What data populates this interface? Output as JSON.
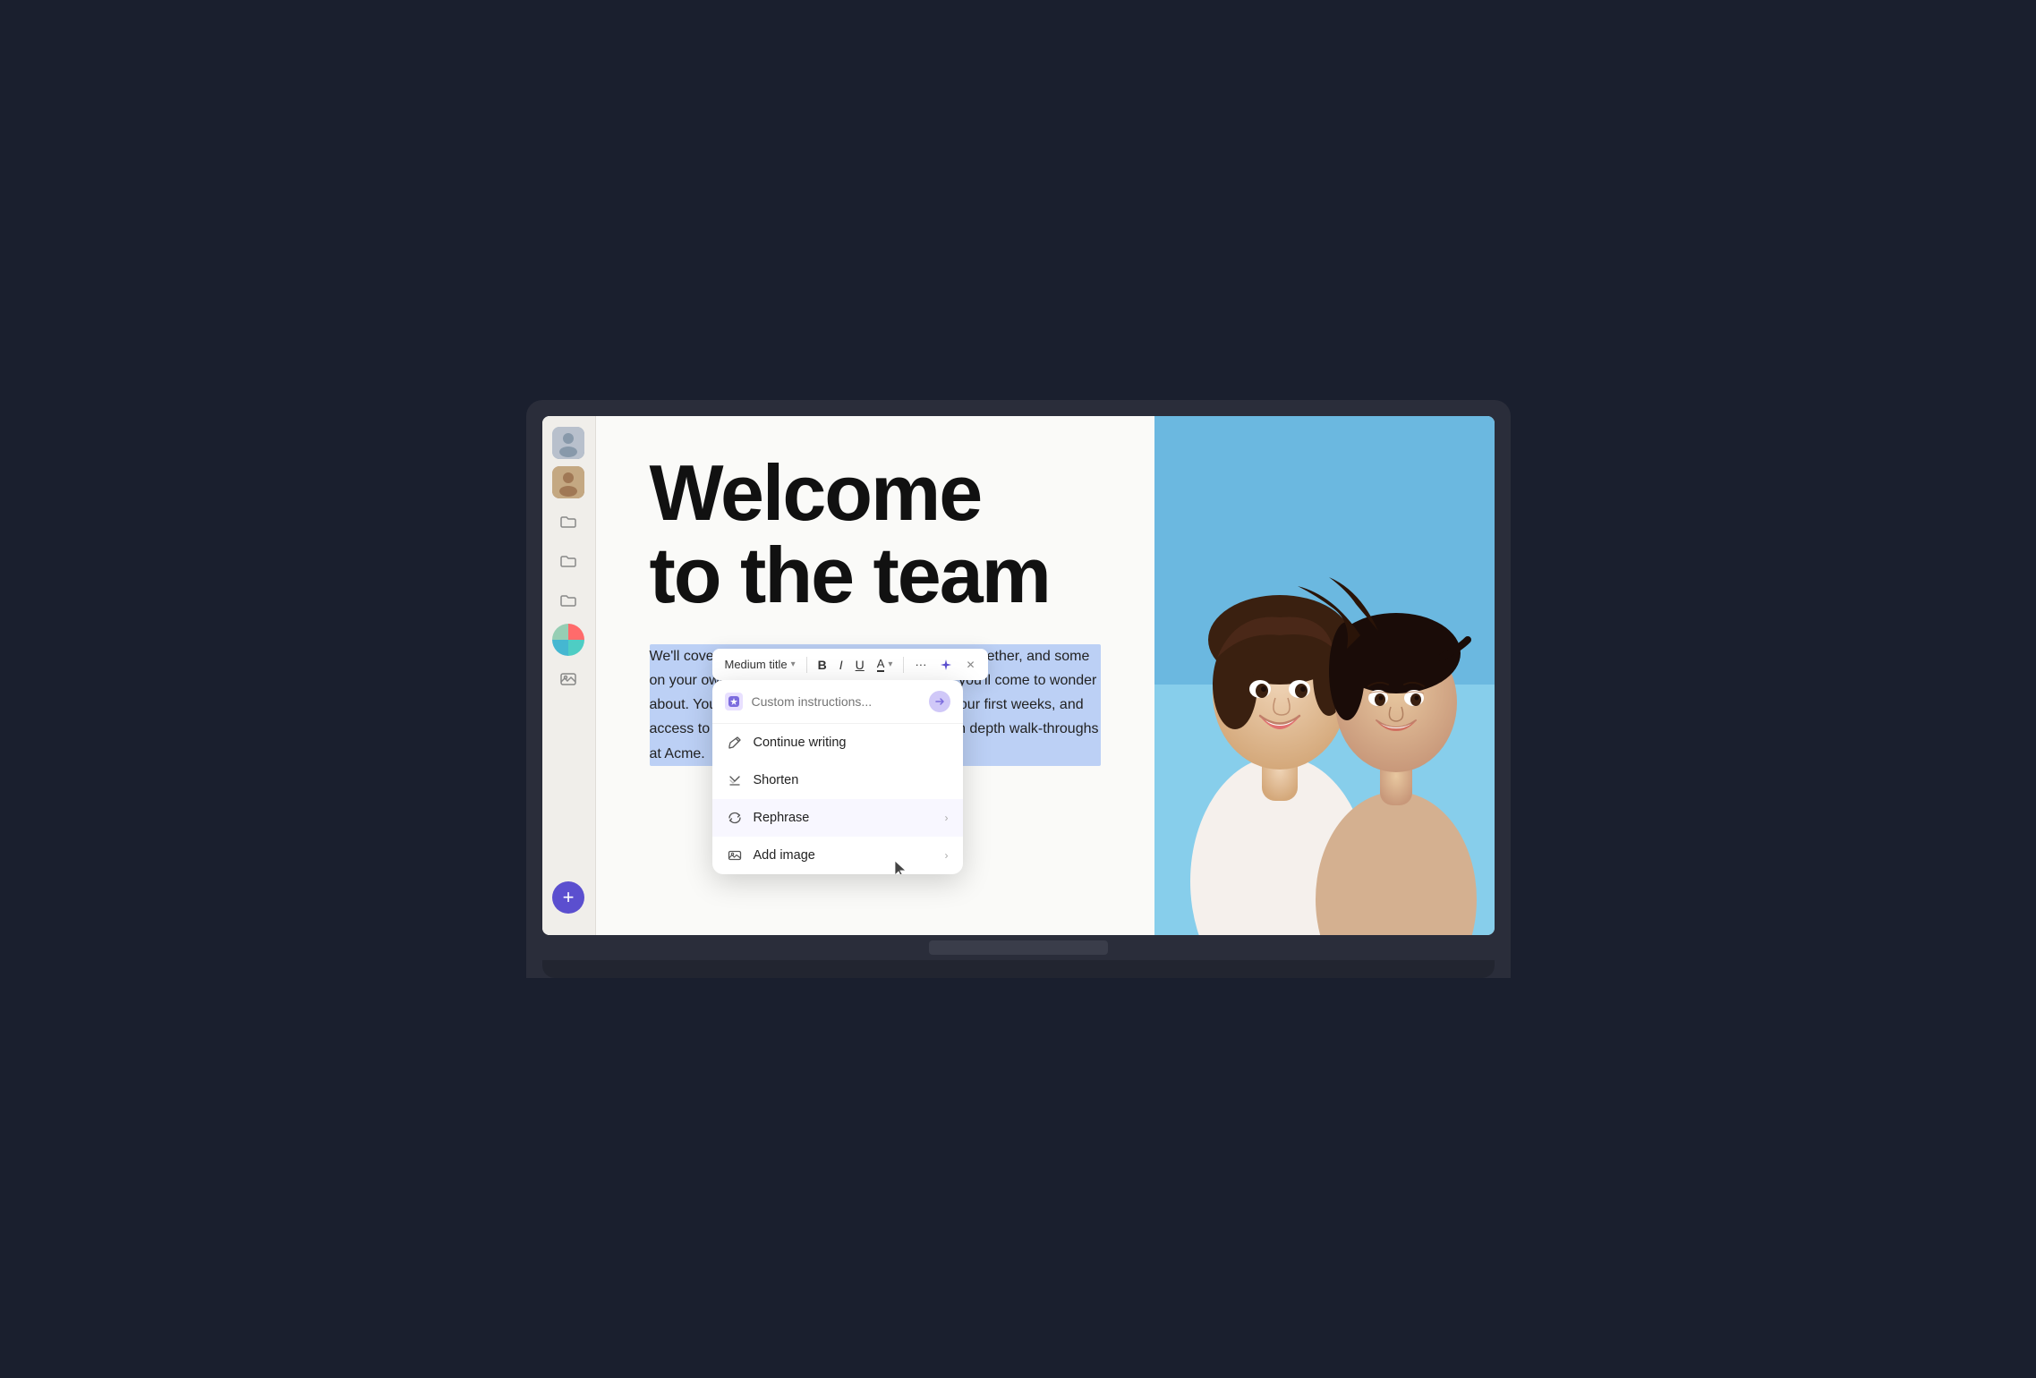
{
  "page": {
    "title": "Welcome\nto the team",
    "body_text": "We'll cover a lot in your first weeks, in person and together, and some on your own. This doc covers most of the basics you'll come to wonder about. You'll find links and shortcuts throughout your first weeks, and access to guides and reports—you'll have more in depth walk-throughs at Acme."
  },
  "toolbar": {
    "format_label": "Medium title",
    "bold_label": "B",
    "italic_label": "I",
    "underline_label": "U",
    "text_color_label": "A",
    "more_label": "···"
  },
  "ai_menu": {
    "search_placeholder": "Custom instructions...",
    "items": [
      {
        "id": "continue-writing",
        "label": "Continue writing",
        "icon": "pencil",
        "has_arrow": false
      },
      {
        "id": "shorten",
        "label": "Shorten",
        "icon": "compress",
        "has_arrow": false
      },
      {
        "id": "rephrase",
        "label": "Rephrase",
        "icon": "rephrase",
        "has_arrow": true
      },
      {
        "id": "add-image",
        "label": "Add image",
        "icon": "image",
        "has_arrow": true
      }
    ]
  },
  "sidebar": {
    "icons": [
      {
        "id": "avatar1",
        "type": "avatar"
      },
      {
        "id": "avatar2",
        "type": "avatar2"
      },
      {
        "id": "folder1",
        "type": "folder"
      },
      {
        "id": "folder2",
        "type": "folder"
      },
      {
        "id": "folder3",
        "type": "folder"
      },
      {
        "id": "color",
        "type": "color"
      },
      {
        "id": "image",
        "type": "image"
      }
    ],
    "add_button_label": "+"
  },
  "colors": {
    "selection_bg": "#bcd0f5",
    "accent": "#5b4fcf",
    "toolbar_bg": "#ffffff",
    "menu_bg": "#ffffff"
  }
}
